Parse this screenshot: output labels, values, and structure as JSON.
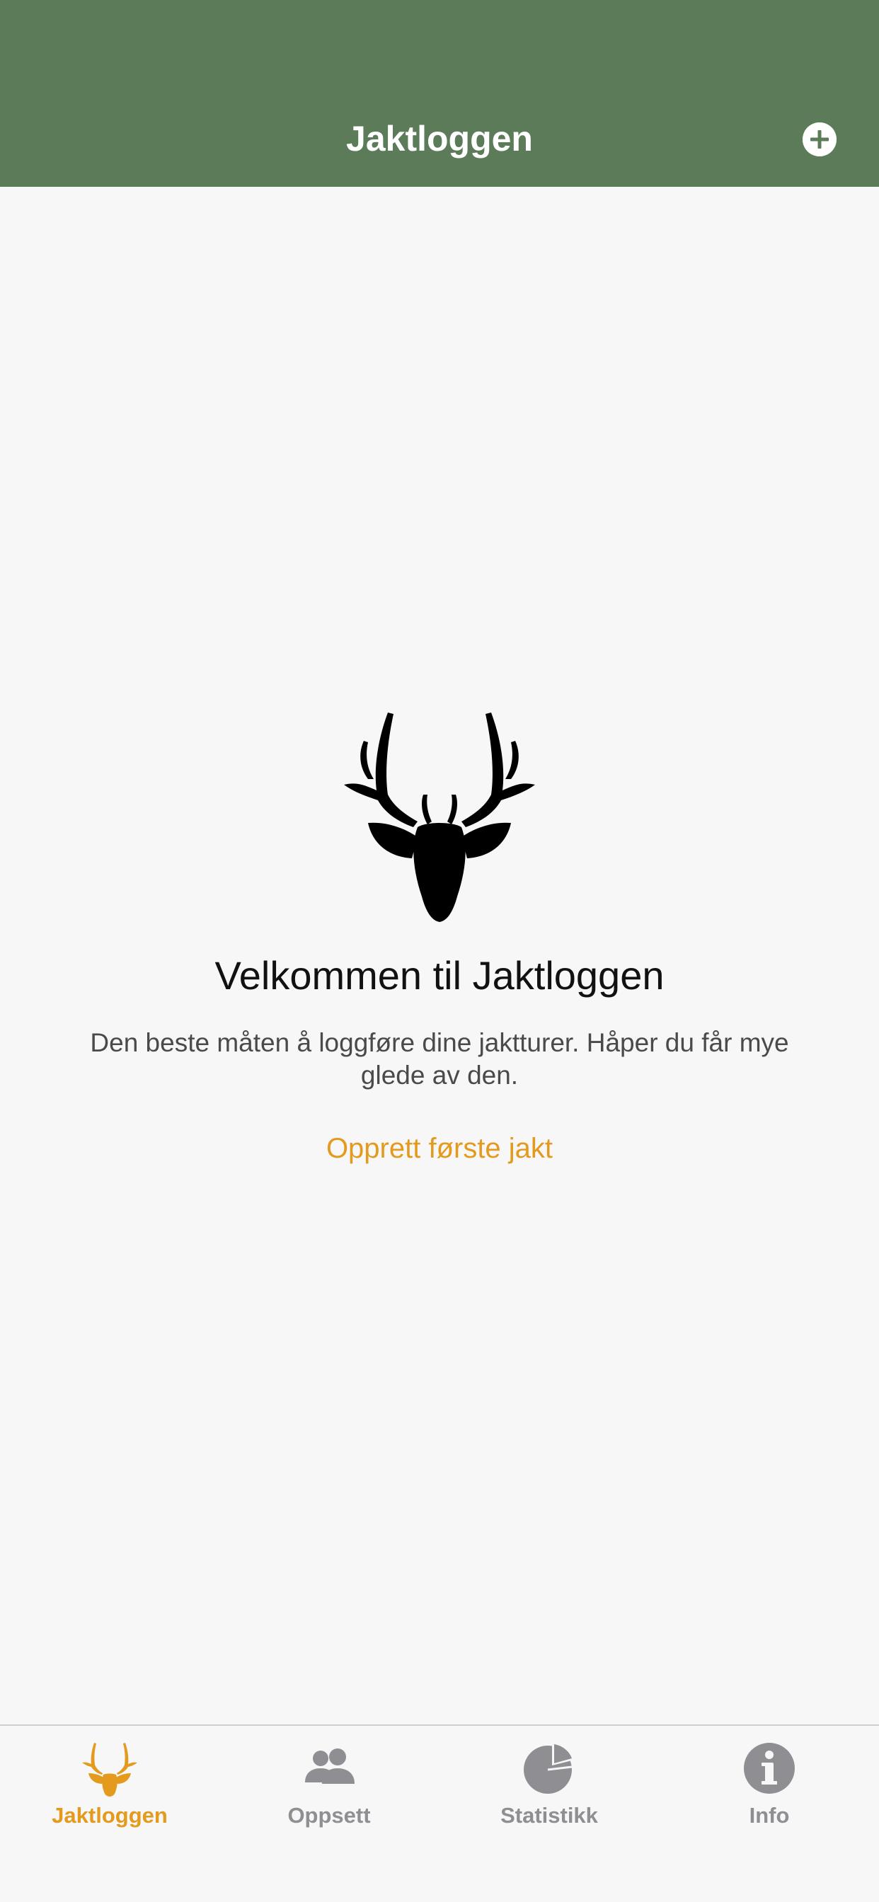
{
  "header": {
    "title": "Jaktloggen",
    "add_icon": "plus-circle-icon",
    "background_color": "#5b7b59"
  },
  "empty_state": {
    "logo_icon": "deer-head-icon",
    "title": "Velkommen til Jaktloggen",
    "description": "Den beste måten å loggføre dine jaktturer. Håper du får mye glede av den.",
    "action_label": "Opprett første jakt",
    "action_color": "#e39a1d"
  },
  "tabbar": {
    "active_color": "#e39a1d",
    "inactive_color": "#8e8e93",
    "tabs": [
      {
        "label": "Jaktloggen",
        "icon": "deer-head-icon",
        "active": true
      },
      {
        "label": "Oppsett",
        "icon": "people-icon",
        "active": false
      },
      {
        "label": "Statistikk",
        "icon": "pie-chart-icon",
        "active": false
      },
      {
        "label": "Info",
        "icon": "info-icon",
        "active": false
      }
    ]
  }
}
